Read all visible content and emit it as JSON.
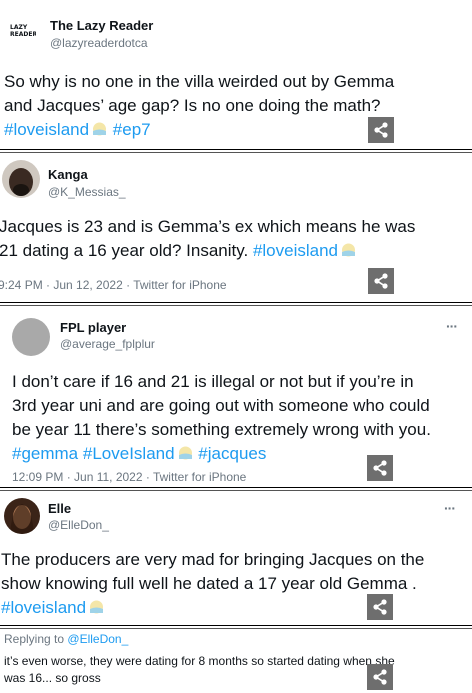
{
  "tweets": [
    {
      "name": "The Lazy Reader",
      "handle": "@lazyreaderdotca",
      "logo_text_1": "LAZY",
      "logo_text_2": "READER",
      "line1": "So why is no one in the villa weirded out by Gemma",
      "line2": "and Jacques’ age gap? Is no one doing the math?",
      "tag1": "#loveisland",
      "tag2": "#ep7"
    },
    {
      "name": "Kanga",
      "handle": "@K_Messias_",
      "line1": "Jacques is 23 and is Gemma’s ex which means he was",
      "line2_text": "21 dating a 16 year old? Insanity.",
      "tag1": "#loveisland",
      "meta": "9:24 PM · Jun 12, 2022 · Twitter for iPhone"
    },
    {
      "name": "FPL player",
      "handle": "@average_fplplur",
      "line1": "I don’t care if 16 and 21 is illegal or not but if you’re in",
      "line2": "3rd year uni and are going out with someone who could",
      "line3": "be year 11 there’s something extremely wrong with you.",
      "tag1": "#gemma",
      "tag2": "#LoveIsland",
      "tag3": "#jacques",
      "meta": "12:09 PM · Jun 11, 2022 · Twitter for iPhone"
    },
    {
      "name": "Elle",
      "handle": "@ElleDon_",
      "line1": "The producers are very mad for bringing Jacques on the",
      "line2": "show knowing full well he dated a 17 year old Gemma .",
      "tag1": "#loveisland"
    }
  ],
  "reply": {
    "prefix": "Replying to",
    "to": "@ElleDon_",
    "line1": "it’s even worse, they were dating for 8 months so started dating when she",
    "line2": "was 16... so gross"
  },
  "more_icon": "more-dots-icon",
  "share_icon": "share-icon",
  "colors": {
    "hashtag": "#1d9bf0",
    "muted": "#6b7680",
    "share_bg": "#6e6e6e"
  }
}
